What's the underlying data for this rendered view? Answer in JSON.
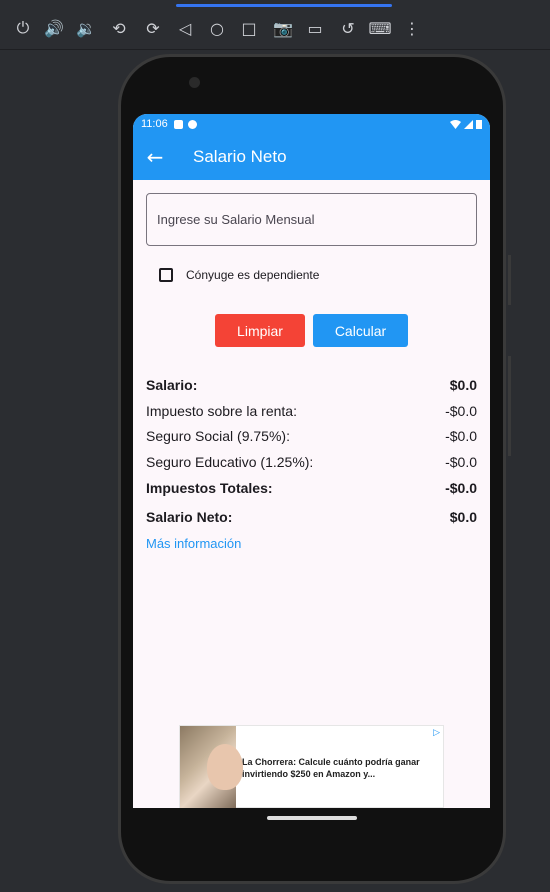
{
  "emulator_toolbar": {
    "icons": [
      "power-icon",
      "volume-up-icon",
      "volume-down-icon",
      "rotate-left-icon",
      "rotate-right-icon",
      "back-icon",
      "home-icon",
      "overview-icon",
      "screenshot-icon",
      "record-icon",
      "undo-icon",
      "keyboard-icon",
      "more-icon"
    ],
    "glyphs": [
      "⏻",
      "🔊",
      "🔉",
      "⟲",
      "⟳",
      "◁",
      "○",
      "□",
      "📷",
      "▭",
      "↺",
      "⌨",
      "⋮"
    ]
  },
  "status_bar": {
    "time": "11:06"
  },
  "app_bar": {
    "back_glyph": "←",
    "title": "Salario Neto"
  },
  "form": {
    "salary_placeholder": "Ingrese su Salario Mensual",
    "spouse_label": "Cónyuge es dependiente",
    "spouse_checked": false,
    "clear_label": "Limpiar",
    "calc_label": "Calcular"
  },
  "results": [
    {
      "label": "Salario:",
      "value": "$0.0",
      "bold": true
    },
    {
      "label": "Impuesto sobre la renta:",
      "value": "-$0.0",
      "bold": false
    },
    {
      "label": "Seguro Social (9.75%):",
      "value": "-$0.0",
      "bold": false
    },
    {
      "label": "Seguro Educativo (1.25%):",
      "value": "-$0.0",
      "bold": false
    },
    {
      "label": "Impuestos Totales:",
      "value": "-$0.0",
      "bold": true
    }
  ],
  "net": {
    "label": "Salario Neto:",
    "value": "$0.0"
  },
  "more_info": "Más información",
  "ad": {
    "text": "La Chorrera: Calcule cuánto podría ganar invirtiendo $250 en Amazon y...",
    "badge": "▷"
  },
  "colors": {
    "primary": "#2196f3",
    "danger": "#f44336",
    "background": "#fdf7fb"
  }
}
